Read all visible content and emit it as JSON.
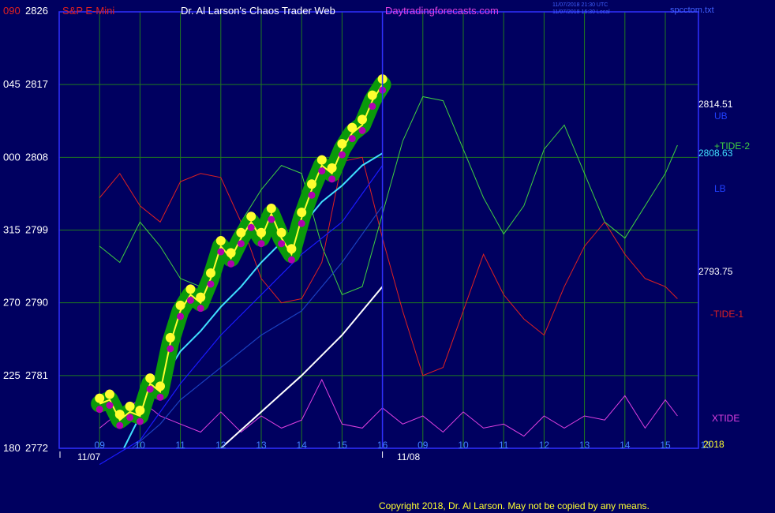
{
  "header": {
    "symbol": "S&P E-Mini",
    "title": "Dr. Al Larson's Chaos Trader Web",
    "site": "Daytradingforecasts.com",
    "timestamp_utc": "11/07/2018 21:30 UTC",
    "timestamp_local": "11/07/2018 16:30 Local",
    "file": "spcctom.txt"
  },
  "footer": {
    "copyright": "Copyright 2018, Dr. Al Larson. May not be copied by any means."
  },
  "colors": {
    "background": "#000060",
    "grid": "#1f7a1f",
    "frame": "#3030ff",
    "tide_minus1": "#e02020",
    "tide_plus2": "#40d040",
    "xtide": "#e040e0",
    "ub_line": "#1a1aff",
    "lb_line": "#1a40c0",
    "cyan_avg": "#40e0ff",
    "white_line": "#ffffff",
    "price_band": "#0a9a0a",
    "price_high": "#ffff30",
    "price_low": "#b000b0"
  },
  "chart_data": {
    "type": "line",
    "title": "S&P E-Mini",
    "y_axis_price": {
      "ticks": [
        2772,
        2781,
        2790,
        2799,
        2808,
        2817,
        2826
      ],
      "range": [
        2772,
        2826
      ]
    },
    "y_axis_angle_labels": [
      "180",
      "225",
      "270",
      "315",
      "000",
      "045",
      "090"
    ],
    "x_axis": {
      "hour_ticks": [
        "09",
        "10",
        "11",
        "12",
        "13",
        "14",
        "15",
        "16",
        "09",
        "10",
        "11",
        "12",
        "13",
        "14",
        "15",
        "13"
      ],
      "date_labels": [
        "11/07",
        "11/08"
      ]
    },
    "right_labels": {
      "ub_value": "2814.51",
      "ub_label": "UB",
      "tide2_label": "+TIDE-2",
      "cyan_value": "2808.63",
      "lb_label": "LB",
      "lb_value": "2793.75",
      "tide1_label": "-TIDE-1",
      "xtide_label": "XTIDE",
      "year_label": "2018"
    },
    "price_bars": {
      "x_hours": [
        9.0,
        9.25,
        9.5,
        9.75,
        10.0,
        10.25,
        10.5,
        10.75,
        11.0,
        11.25,
        11.5,
        11.75,
        12.0,
        12.25,
        12.5,
        12.75,
        13.0,
        13.25,
        13.5,
        13.75,
        14.0,
        14.25,
        14.5,
        14.75,
        15.0,
        15.25,
        15.5,
        15.75,
        16.0
      ],
      "close": [
        2777.5,
        2778.0,
        2775.5,
        2776.5,
        2776.0,
        2780.0,
        2779.0,
        2785.0,
        2789.0,
        2791.0,
        2790.0,
        2793.0,
        2797.0,
        2795.5,
        2798.0,
        2800.0,
        2798.0,
        2801.0,
        2798.0,
        2796.0,
        2800.5,
        2804.0,
        2807.0,
        2806.0,
        2809.0,
        2811.0,
        2812.0,
        2815.0,
        2817.0
      ]
    },
    "series": [
      {
        "name": "-TIDE-1",
        "x_hours": [
          9.0,
          9.5,
          10.0,
          10.5,
          11.0,
          11.5,
          12.0,
          12.5,
          13.0,
          13.5,
          14.0,
          14.5,
          15.0,
          15.5,
          16.0,
          16.5,
          17.0,
          17.5,
          18.0,
          18.5,
          19.0,
          19.5,
          20.0,
          20.5,
          21.0,
          21.5,
          22.0,
          22.5,
          23.0,
          23.3
        ],
        "values": [
          2803.0,
          2806.0,
          2802.0,
          2800.0,
          2805.0,
          2806.0,
          2805.5,
          2800.0,
          2793.0,
          2790.0,
          2790.5,
          2795.0,
          2807.5,
          2808.0,
          2798.0,
          2789.0,
          2781.0,
          2782.0,
          2789.0,
          2796.0,
          2791.0,
          2788.0,
          2786.0,
          2792.0,
          2797.0,
          2800.0,
          2796.0,
          2793.0,
          2792.0,
          2790.5
        ]
      },
      {
        "name": "+TIDE-2",
        "x_hours": [
          9.0,
          9.5,
          10.0,
          10.5,
          11.0,
          11.5,
          12.0,
          12.5,
          13.0,
          13.5,
          14.0,
          14.5,
          15.0,
          15.5,
          16.0,
          16.5,
          17.0,
          17.5,
          18.0,
          18.5,
          19.0,
          19.5,
          20.0,
          20.5,
          21.0,
          21.5,
          22.0,
          22.5,
          23.0,
          23.3
        ],
        "values": [
          2797.0,
          2795.0,
          2800.0,
          2797.0,
          2793.0,
          2792.0,
          2795.0,
          2800.0,
          2804.0,
          2807.0,
          2806.0,
          2797.0,
          2791.0,
          2792.0,
          2801.0,
          2810.0,
          2815.5,
          2815.0,
          2809.0,
          2803.0,
          2798.5,
          2802.0,
          2809.0,
          2812.0,
          2806.0,
          2800.0,
          2798.0,
          2802.0,
          2806.0,
          2809.5
        ]
      },
      {
        "name": "XTIDE",
        "x_hours": [
          9.0,
          9.5,
          10.0,
          10.5,
          11.0,
          11.5,
          12.0,
          12.5,
          13.0,
          13.5,
          14.0,
          14.5,
          15.0,
          15.5,
          16.0,
          16.5,
          17.0,
          17.5,
          18.0,
          18.5,
          19.0,
          19.5,
          20.0,
          20.5,
          21.0,
          21.5,
          22.0,
          22.5,
          23.0,
          23.3
        ],
        "values": [
          2774.5,
          2776.5,
          2778.0,
          2776.0,
          2775.0,
          2774.0,
          2776.5,
          2774.0,
          2776.0,
          2774.5,
          2775.5,
          2780.5,
          2775.0,
          2774.5,
          2777.0,
          2775.0,
          2776.0,
          2774.0,
          2776.5,
          2774.5,
          2775.0,
          2773.5,
          2776.0,
          2774.5,
          2776.0,
          2775.5,
          2778.5,
          2774.5,
          2778.0,
          2776.0
        ]
      },
      {
        "name": "UB",
        "x_hours": [
          9.0,
          10.0,
          11.0,
          12.0,
          13.0,
          14.0,
          15.0,
          16.0
        ],
        "values": [
          2770.0,
          2773.0,
          2780.0,
          2786.0,
          2791.0,
          2796.0,
          2800.0,
          2807.0
        ]
      },
      {
        "name": "LB",
        "x_hours": [
          9.8,
          10.5,
          11.0,
          12.0,
          13.0,
          14.0,
          15.0,
          16.0
        ],
        "values": [
          2772.0,
          2775.0,
          2778.0,
          2782.0,
          2786.0,
          2789.0,
          2795.0,
          2802.0
        ]
      },
      {
        "name": "Cyan",
        "x_hours": [
          9.6,
          10.0,
          10.5,
          11.0,
          11.5,
          12.0,
          12.5,
          13.0,
          13.5,
          14.0,
          14.5,
          15.0,
          15.5,
          16.0
        ],
        "values": [
          2772.0,
          2776.0,
          2780.0,
          2784.0,
          2786.5,
          2789.5,
          2792.0,
          2795.0,
          2797.5,
          2799.5,
          2802.5,
          2804.5,
          2807.0,
          2808.5
        ]
      },
      {
        "name": "White",
        "x_hours": [
          12.0,
          13.0,
          14.0,
          15.0,
          16.0
        ],
        "values": [
          2772.0,
          2776.5,
          2781.0,
          2786.0,
          2792.0
        ]
      }
    ],
    "grid": true,
    "legend": "right"
  }
}
